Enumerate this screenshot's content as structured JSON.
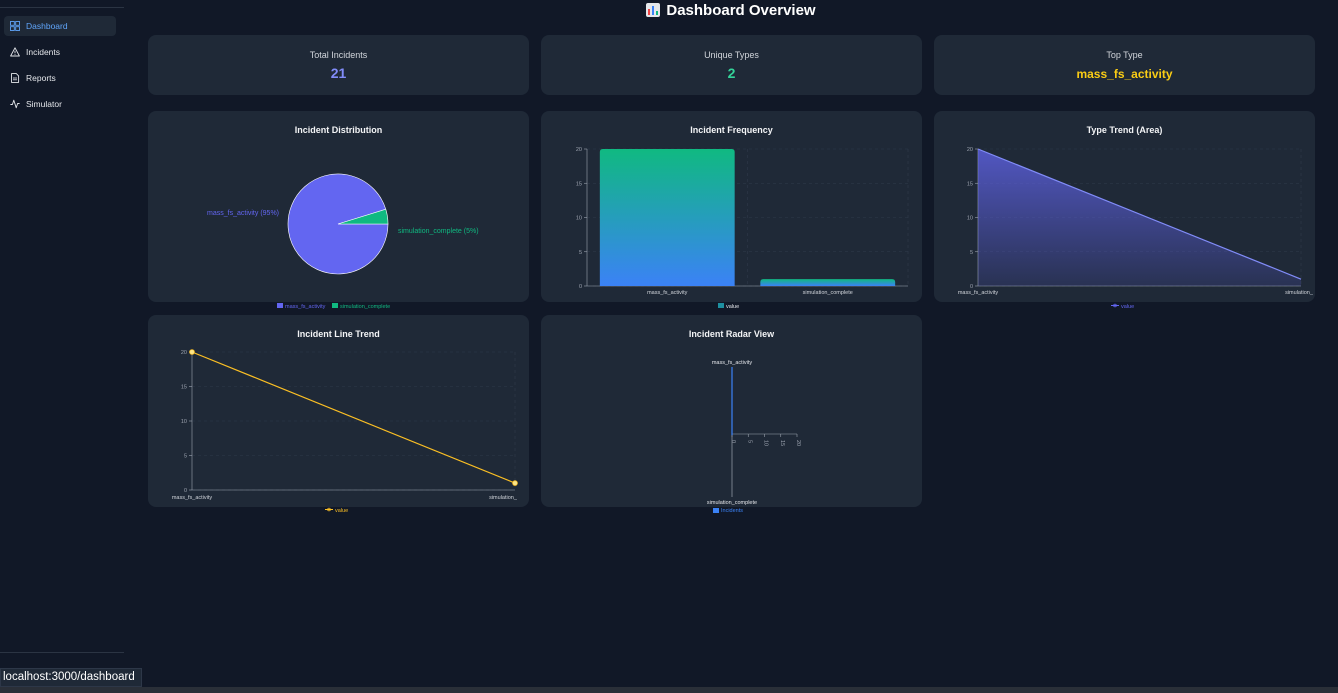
{
  "sidebar": {
    "items": [
      {
        "label": "Dashboard",
        "icon": "layout-grid-icon",
        "active": true
      },
      {
        "label": "Incidents",
        "icon": "alert-triangle-icon",
        "active": false
      },
      {
        "label": "Reports",
        "icon": "file-text-icon",
        "active": false
      },
      {
        "label": "Simulator",
        "icon": "activity-icon",
        "active": false
      }
    ]
  },
  "header": {
    "title": "Dashboard Overview",
    "icon": "bar-chart-icon"
  },
  "stats": [
    {
      "label": "Total Incidents",
      "value": "21",
      "color": "#818cf8"
    },
    {
      "label": "Unique Types",
      "value": "2",
      "color": "#34d399"
    },
    {
      "label": "Top Type",
      "value": "mass_fs_activity",
      "color": "#facc15"
    }
  ],
  "colors": {
    "accent": "#60a5fa",
    "purple": "#6366f1",
    "green": "#10b981",
    "yellow": "#fbbf24",
    "blue": "#3b82f6"
  },
  "chart_data": [
    {
      "type": "pie",
      "title": "Incident Distribution",
      "categories": [
        "mass_fs_activity",
        "simulation_complete"
      ],
      "values": [
        20,
        1
      ],
      "slice_labels": [
        "mass_fs_activity (95%)",
        "simulation_complete (5%)"
      ],
      "legend": [
        "mass_fs_activity",
        "simulation_complete"
      ],
      "legend_position": "bottom"
    },
    {
      "type": "bar",
      "title": "Incident Frequency",
      "categories": [
        "mass_fs_activity",
        "simulation_complete"
      ],
      "series": [
        {
          "name": "value",
          "values": [
            20,
            1
          ]
        }
      ],
      "yticks": [
        "0",
        "5",
        "10",
        "15",
        "20"
      ],
      "ylim": [
        0,
        20
      ],
      "grid": true,
      "legend_position": "bottom"
    },
    {
      "type": "area",
      "title": "Type Trend (Area)",
      "categories": [
        "mass_fs_activity",
        "simulation_"
      ],
      "series": [
        {
          "name": "value",
          "values": [
            20,
            1
          ]
        }
      ],
      "yticks": [
        "0",
        "5",
        "10",
        "15",
        "20"
      ],
      "ylim": [
        0,
        20
      ],
      "grid": true,
      "legend_position": "bottom"
    },
    {
      "type": "line",
      "title": "Incident Line Trend",
      "categories": [
        "mass_fs_activity",
        "simulation_"
      ],
      "series": [
        {
          "name": "value",
          "values": [
            20,
            1
          ]
        }
      ],
      "yticks": [
        "0",
        "5",
        "10",
        "15",
        "20"
      ],
      "ylim": [
        0,
        20
      ],
      "grid": true,
      "legend_position": "bottom"
    },
    {
      "type": "radar",
      "title": "Incident Radar View",
      "categories": [
        "mass_fs_activity",
        "simulation_complete"
      ],
      "series": [
        {
          "name": "Incidents",
          "values": [
            20,
            1
          ]
        }
      ],
      "rticks": [
        "0",
        "5",
        "10",
        "15",
        "20"
      ],
      "legend_position": "bottom"
    }
  ],
  "status_bar": {
    "url": "localhost:3000/dashboard"
  }
}
